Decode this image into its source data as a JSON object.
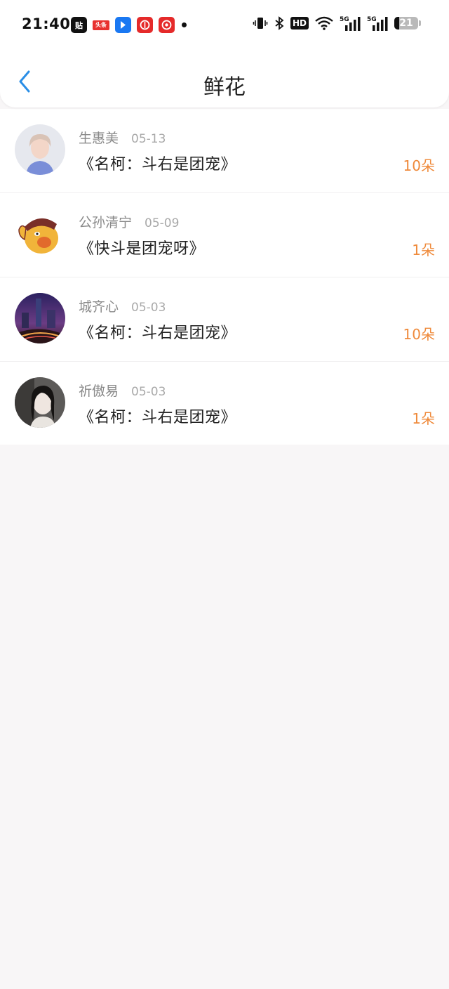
{
  "status_bar": {
    "time": "21:40",
    "notification_icons": [
      "tieba-icon",
      "toutiao-icon",
      "blue-app-icon",
      "red-app-icon",
      "netease-icon"
    ],
    "toutiao_label": "头条",
    "tie_label": "贴",
    "hd_label": "HD",
    "signal_label": "5G",
    "battery": "21"
  },
  "header": {
    "title": "鲜花",
    "back_icon": "chevron-left-icon"
  },
  "colors": {
    "accent_blue": "#2a8ee6",
    "count_orange": "#ef8a3b",
    "page_background": "#f8f6f7"
  },
  "items": [
    {
      "name": "生惠美",
      "date": "05-13",
      "work": "《名柯：斗右是团宠》",
      "count": "10朵"
    },
    {
      "name": "公孙清宁",
      "date": "05-09",
      "work": "《快斗是团宠呀》",
      "count": "1朵"
    },
    {
      "name": "城齐心",
      "date": "05-03",
      "work": "《名柯：斗右是团宠》",
      "count": "10朵"
    },
    {
      "name": "祈傲易",
      "date": "05-03",
      "work": "《名柯：斗右是团宠》",
      "count": "1朵"
    }
  ]
}
